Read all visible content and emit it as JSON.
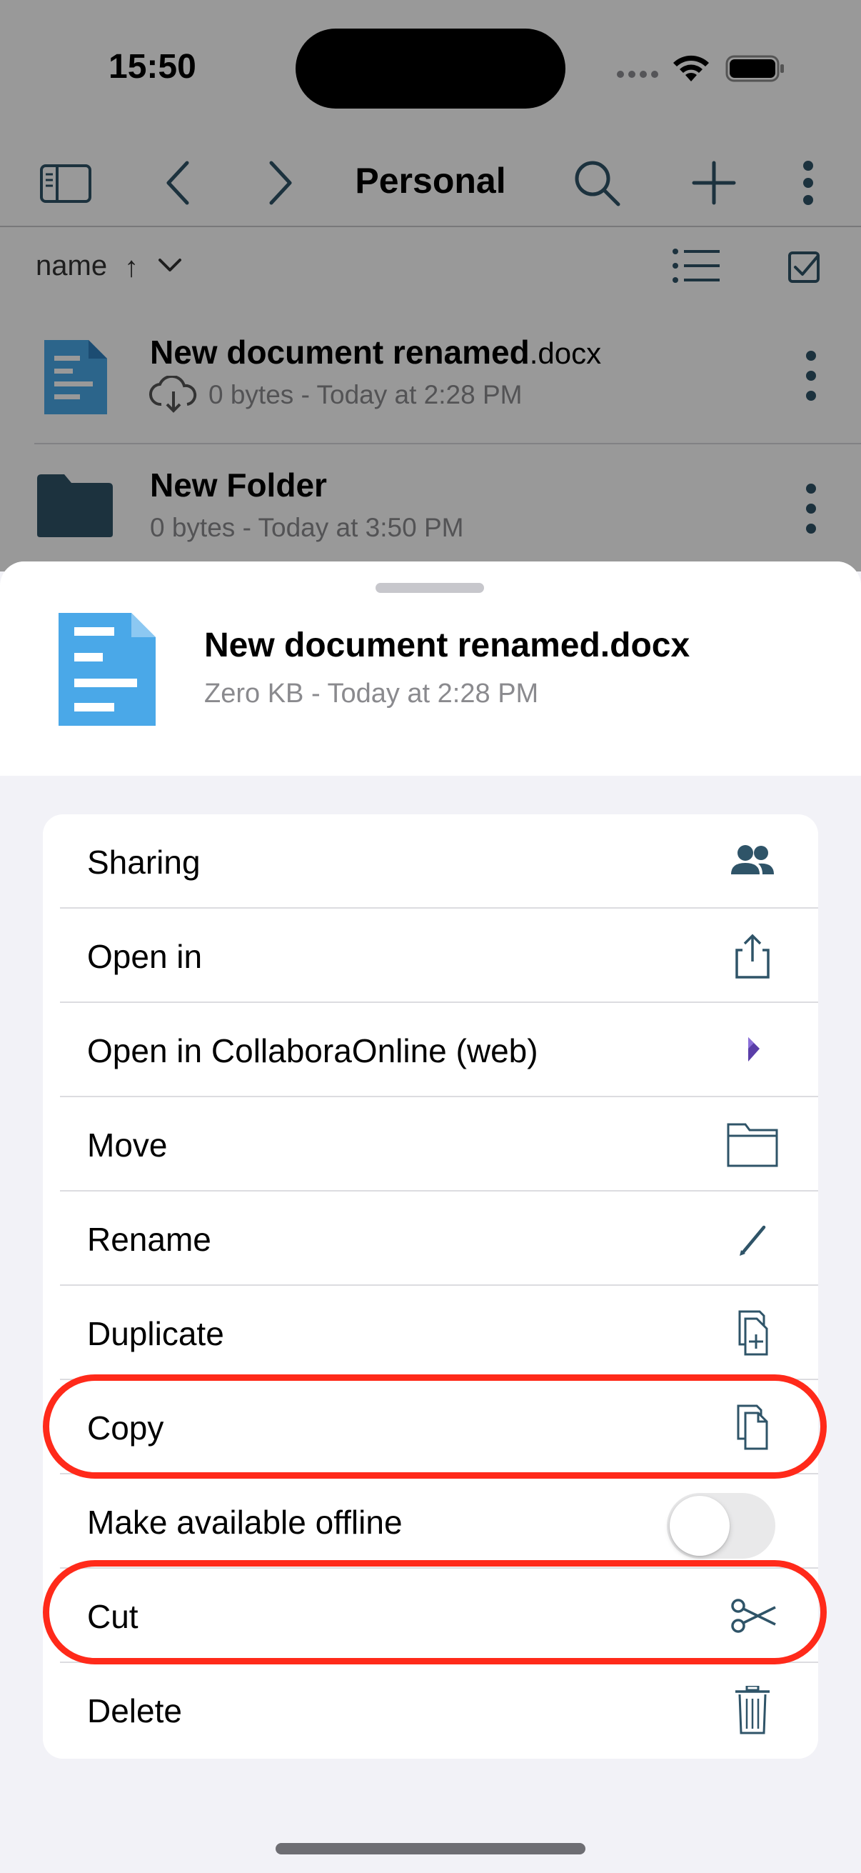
{
  "status_bar": {
    "time": "15:50"
  },
  "nav": {
    "title": "Personal"
  },
  "sort": {
    "label": "name",
    "direction": "↑"
  },
  "files": [
    {
      "name": "New document renamed",
      "ext": ".docx",
      "meta": "0 bytes - Today at 2:28 PM",
      "icon": "document-icon"
    },
    {
      "name": "New Folder",
      "ext": "",
      "meta": "0 bytes - Today at 3:50 PM",
      "icon": "folder-icon"
    }
  ],
  "sheet": {
    "file_name": "New document renamed.docx",
    "file_meta": "Zero KB - Today at 2:28 PM"
  },
  "actions": [
    {
      "label": "Sharing",
      "icon": "people-icon"
    },
    {
      "label": "Open in",
      "icon": "share-icon"
    },
    {
      "label": "Open in CollaboraOnline (web)",
      "icon": "collabora-icon"
    },
    {
      "label": "Move",
      "icon": "folder-outline-icon"
    },
    {
      "label": "Rename",
      "icon": "pencil-icon"
    },
    {
      "label": "Duplicate",
      "icon": "duplicate-icon"
    },
    {
      "label": "Copy",
      "icon": "copy-icon"
    },
    {
      "label": "Make available offline",
      "toggle": false
    },
    {
      "label": "Cut",
      "icon": "scissors-icon"
    },
    {
      "label": "Delete",
      "icon": "trash-icon"
    }
  ],
  "colors": {
    "icon_teal": "#2f5468",
    "doc_blue": "#4aa8e8",
    "highlight": "#ff2a1a",
    "collabora": "#5a3ea8"
  }
}
